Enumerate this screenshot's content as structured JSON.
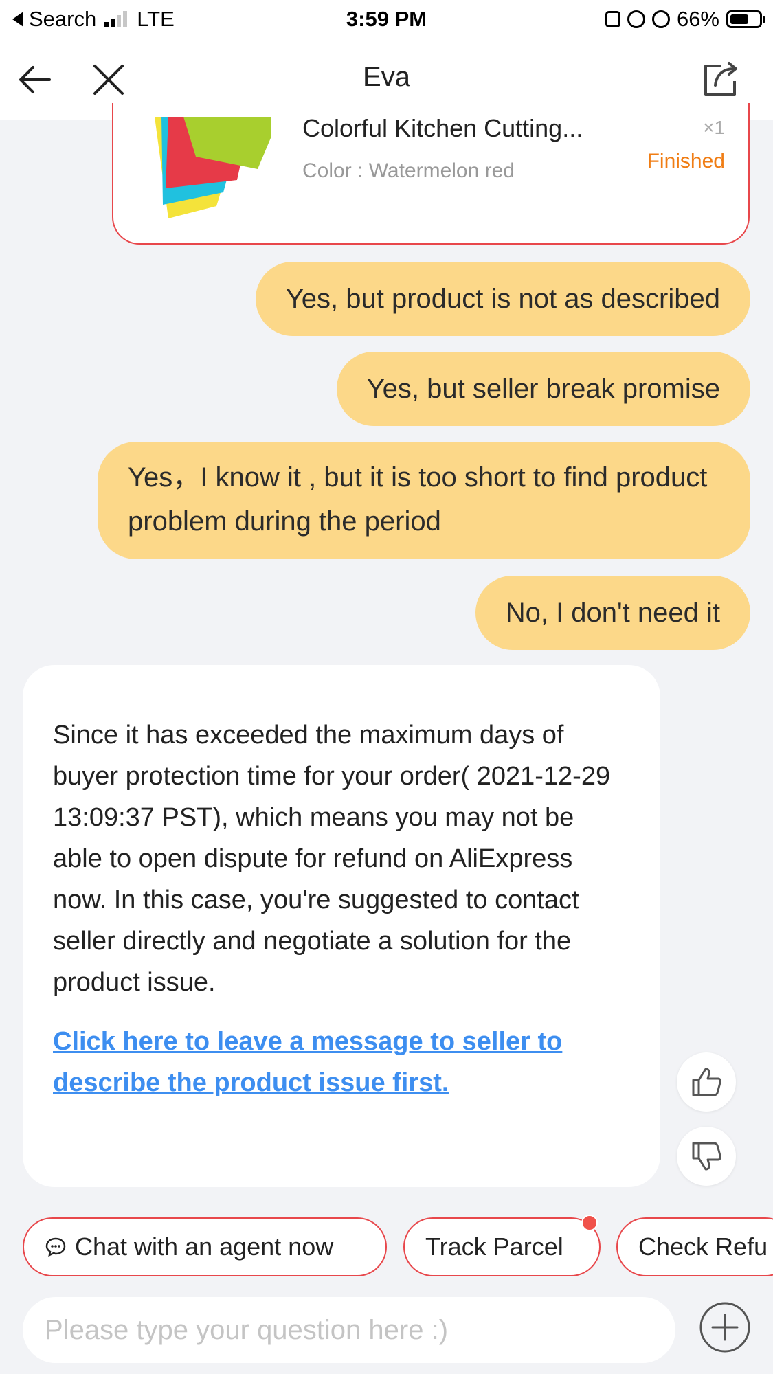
{
  "status_bar": {
    "back_app": "Search",
    "network": "LTE",
    "time": "3:59 PM",
    "battery": "66%",
    "battery_level": 0.66
  },
  "header": {
    "title": "Eva"
  },
  "product": {
    "title": "Colorful Kitchen Cutting...",
    "variant": "Color : Watermelon red",
    "quantity": "×1",
    "status": "Finished"
  },
  "messages": {
    "user_1": "Yes, but product is not as described",
    "user_2": "Yes, but seller break promise",
    "user_3": "Yes，I know it , but it is too short to find product problem during the period",
    "user_4": "No, I don't need it",
    "bot": "Since it has exceeded the maximum days of buyer protection time for your order( 2021-12-29 13:09:37 PST), which means you may not be able to open dispute for refund on AliExpress now. In this case, you're suggested to contact seller directly and negotiate a solution for the product issue.",
    "bot_link": "Click here to leave a message to seller to describe the product issue first."
  },
  "quick_replies": {
    "chat_agent": "Chat with an agent now",
    "track_parcel": "Track Parcel",
    "check_refund": "Check Refu"
  },
  "input": {
    "placeholder": "Please type your question here :)"
  },
  "colors": {
    "accent_red": "#e8474b",
    "user_bubble": "#fcd889",
    "link_blue": "#3d8ef0",
    "status_orange": "#f07d14"
  }
}
